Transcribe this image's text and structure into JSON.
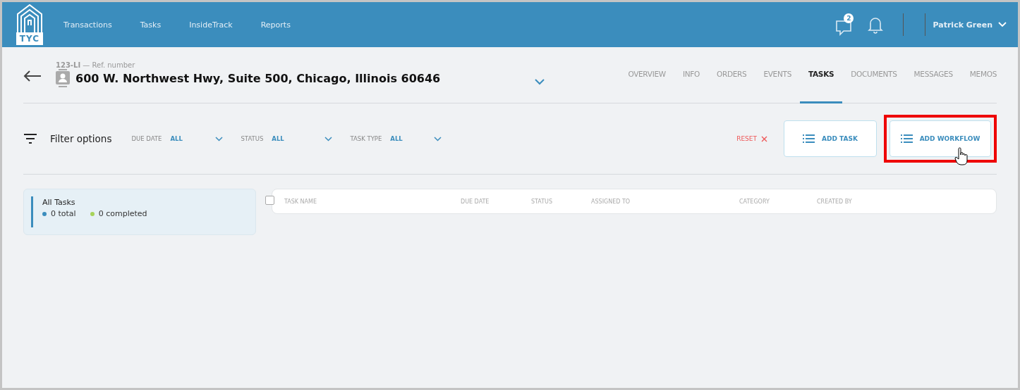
{
  "brand": {
    "logo_text": "TYC"
  },
  "nav": [
    {
      "label": "Transactions"
    },
    {
      "label": "Tasks"
    },
    {
      "label": "InsideTrack"
    },
    {
      "label": "Reports"
    }
  ],
  "header": {
    "message_count": "2",
    "user_name": "Patrick Green"
  },
  "record": {
    "ref": "123-LI",
    "ref_label": "— Ref. number",
    "address": "600 W. Northwest Hwy, Suite 500, Chicago, Illinois 60646"
  },
  "tabs": [
    {
      "label": "OVERVIEW",
      "selected": false
    },
    {
      "label": "INFO",
      "selected": false
    },
    {
      "label": "ORDERS",
      "selected": false
    },
    {
      "label": "EVENTS",
      "selected": false
    },
    {
      "label": "TASKS",
      "selected": true
    },
    {
      "label": "DOCUMENTS",
      "selected": false
    },
    {
      "label": "MESSAGES",
      "selected": false
    },
    {
      "label": "MEMOS",
      "selected": false
    }
  ],
  "filters": {
    "title": "Filter options",
    "items": [
      {
        "label": "DUE DATE",
        "value": "ALL"
      },
      {
        "label": "STATUS",
        "value": "ALL"
      },
      {
        "label": "TASK TYPE",
        "value": "ALL"
      }
    ],
    "reset": "RESET"
  },
  "buttons": [
    {
      "label": "ADD TASK",
      "highlighted": false
    },
    {
      "label": "ADD WORKFLOW",
      "highlighted": true
    }
  ],
  "summary": {
    "title": "All Tasks",
    "stats": [
      {
        "text": "0 total",
        "color": "#3b8dbd"
      },
      {
        "text": "0 completed",
        "color": "#a6d35a"
      }
    ]
  },
  "table": {
    "checked": false,
    "columns": [
      "TASK NAME",
      "DUE DATE",
      "STATUS",
      "ASSIGNED TO",
      "CATEGORY",
      "CREATED BY"
    ]
  }
}
